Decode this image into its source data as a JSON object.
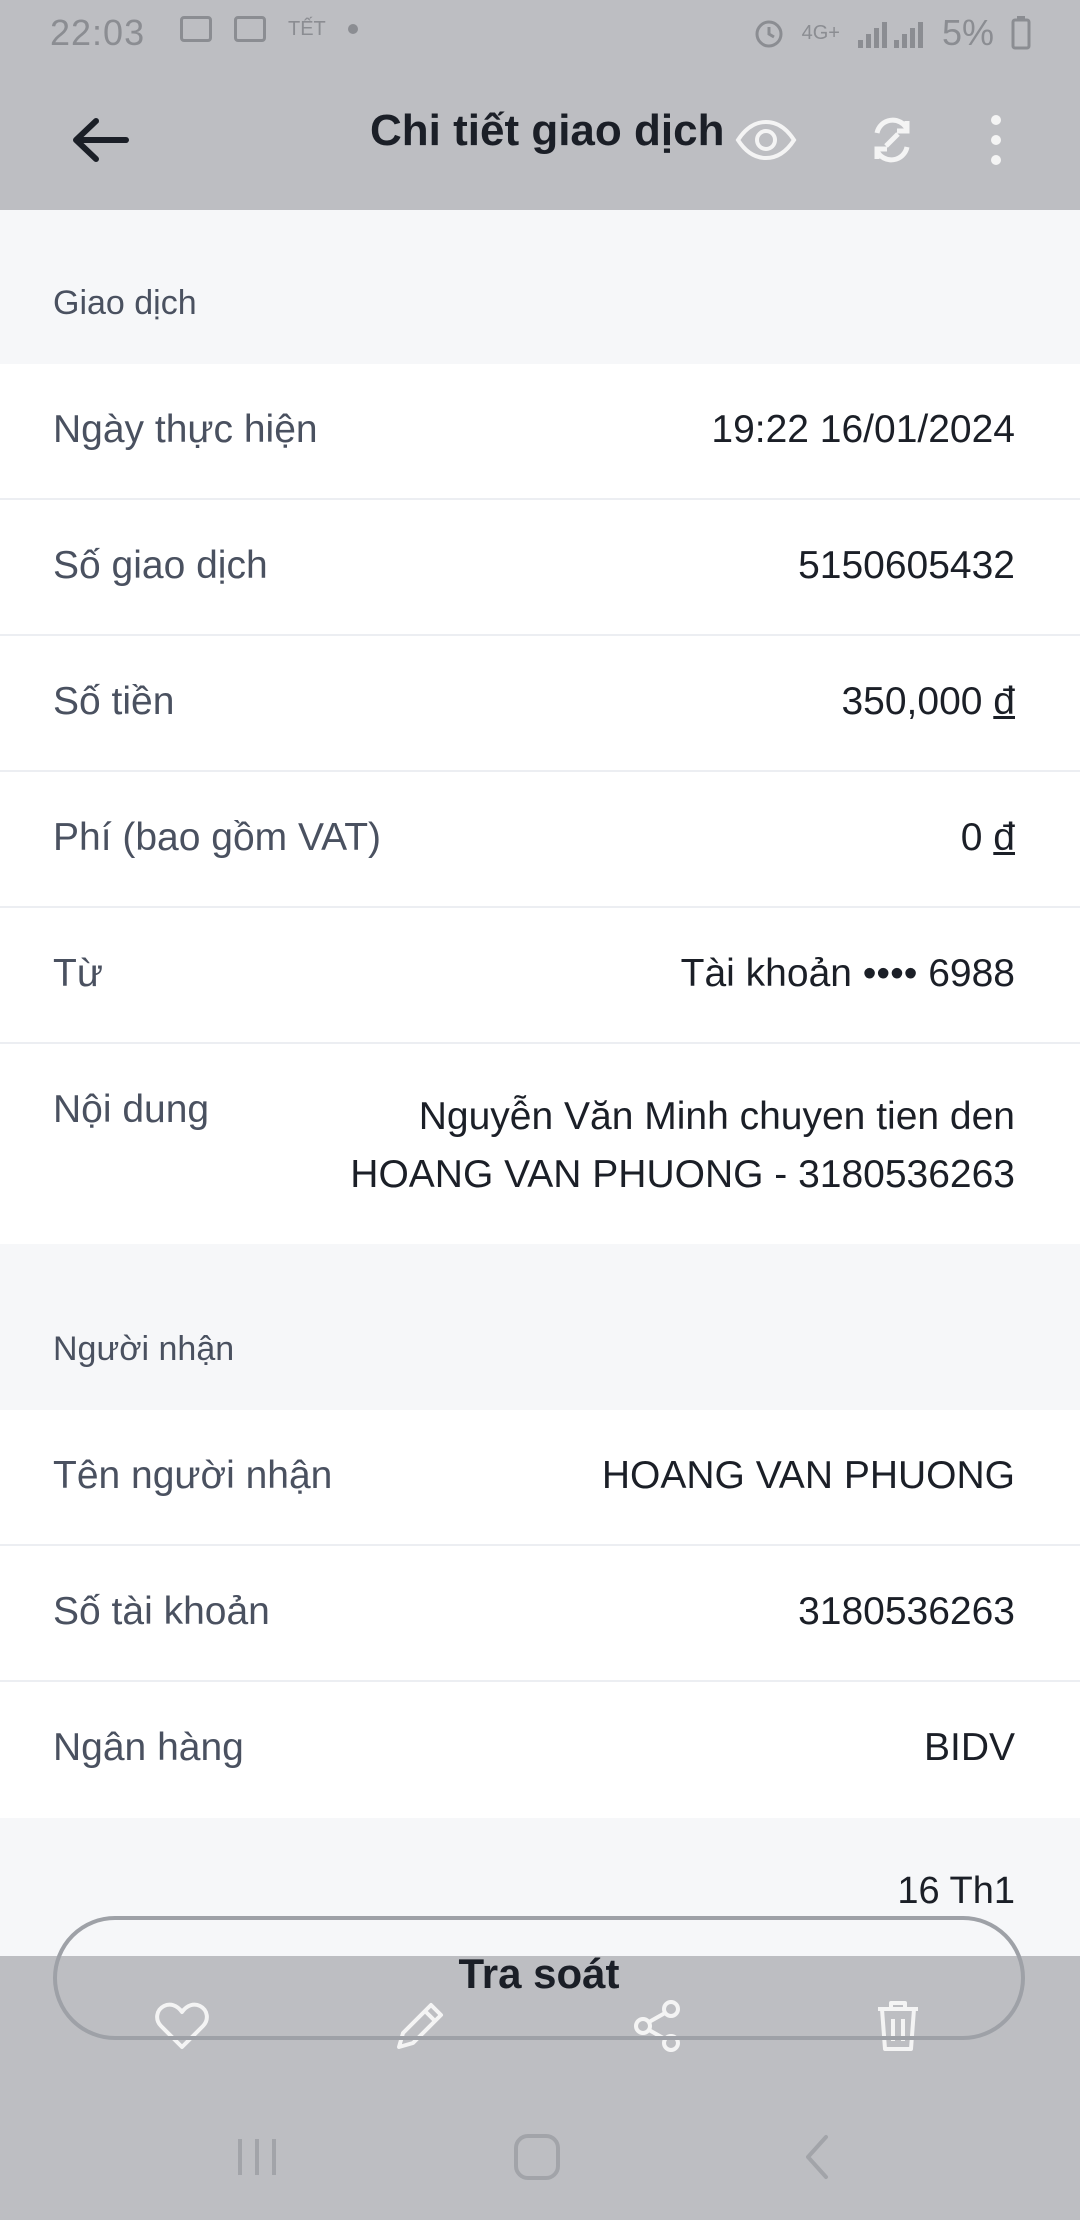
{
  "status_bar": {
    "time": "22:03",
    "tet_label": "TẾT",
    "network": "4G+",
    "battery": "5%",
    "icons": [
      "gallery-icon",
      "cloud-icon",
      "alarm-icon",
      "signal-icon",
      "battery-icon"
    ]
  },
  "header": {
    "title": "Chi tiết giao dịch",
    "icons": [
      "back-arrow-icon",
      "eye-icon",
      "sync-icon",
      "more-vertical-icon"
    ]
  },
  "sections": {
    "transaction": {
      "heading": "Giao dịch",
      "rows": [
        {
          "label": "Ngày thực hiện",
          "value": "19:22 16/01/2024"
        },
        {
          "label": "Số giao dịch",
          "value": "5150605432"
        },
        {
          "label": "Số tiền",
          "value": "350,000",
          "currency": "đ"
        },
        {
          "label": "Phí (bao gồm VAT)",
          "value": "0",
          "currency": "đ"
        },
        {
          "label": "Từ",
          "value": "Tài khoản •••• 6988"
        },
        {
          "label": "Nội dung",
          "value": "Nguyễn Văn Minh chuyen tien den HOANG VAN PHUONG - 3180536263"
        }
      ]
    },
    "recipient": {
      "heading": "Người nhận",
      "rows": [
        {
          "label": "Tên người nhận",
          "value": "HOANG VAN PHUONG"
        },
        {
          "label": "Số tài khoản",
          "value": "3180536263"
        },
        {
          "label": "Ngân hàng",
          "value": "BIDV"
        }
      ]
    }
  },
  "date_footer": "16 Th1",
  "action_button": {
    "label": "Tra soát"
  },
  "bottom_bar": {
    "icons": [
      "heart-icon",
      "edit-pencil-icon",
      "share-icon",
      "trash-icon"
    ]
  },
  "nav_bar": {
    "icons": [
      "recents-icon",
      "home-icon",
      "back-icon"
    ]
  },
  "colors": {
    "overlay_gray": "#bdbec2",
    "page_bg": "#f6f7f9",
    "text_dark": "#1b1f27",
    "text_label": "#4a5160"
  }
}
